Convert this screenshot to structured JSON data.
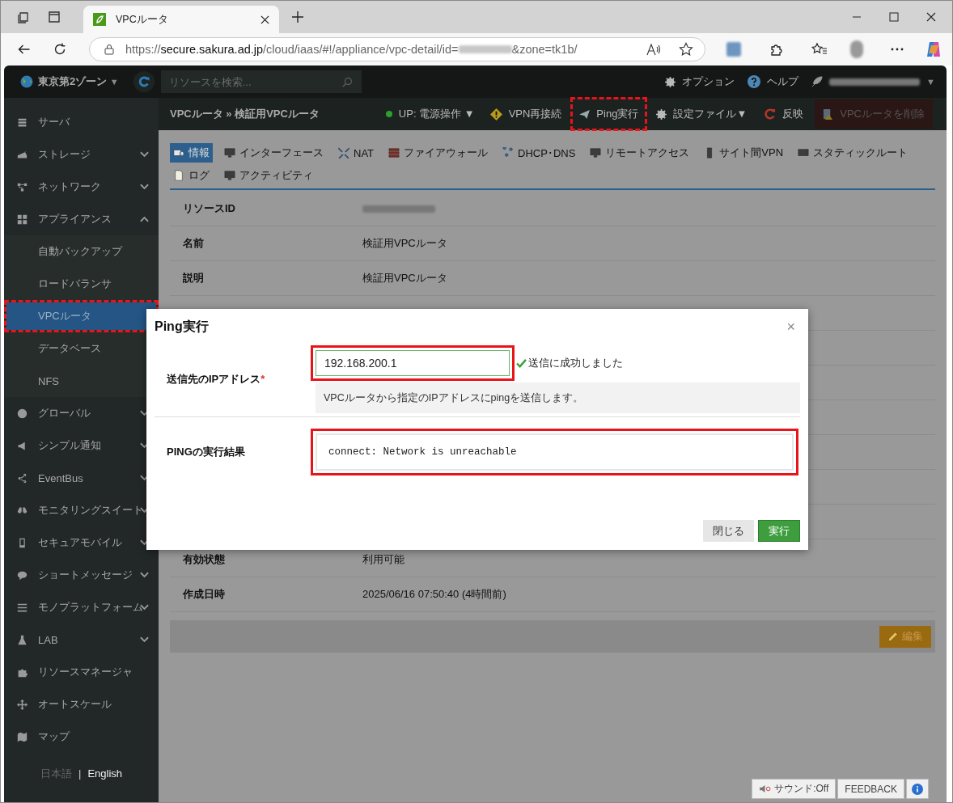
{
  "browser": {
    "tab": {
      "title": "VPCルータ",
      "selected": true
    },
    "url": {
      "scheme": "https://",
      "host": "secure.sakura.ad.jp",
      "path": "/cloud/iaas/#!/appliance/vpc-detail/id=",
      "suffix": "&zone=tk1b/"
    }
  },
  "topbar": {
    "zone": "東京第2ゾーン",
    "zone_caret": "▼",
    "search": {
      "placeholder": "リソースを検索..."
    },
    "links": [
      {
        "label": "オプション"
      },
      {
        "label": "ヘルプ"
      }
    ],
    "user_caret": "▼"
  },
  "sidebar": {
    "items": [
      {
        "label": "サーバ",
        "selected": false
      },
      {
        "label": "ストレージ",
        "selected": false,
        "expanded": false
      },
      {
        "label": "ネットワーク",
        "selected": false,
        "expanded": false
      },
      {
        "label": "アプライアンス",
        "selected": false,
        "expanded": true,
        "children": [
          {
            "label": "自動バックアップ",
            "selected": false,
            "highlighted": false
          },
          {
            "label": "ロードバランサ",
            "selected": false,
            "highlighted": false
          },
          {
            "label": "VPCルータ",
            "selected": true,
            "highlighted": true
          },
          {
            "label": "データベース",
            "selected": false,
            "highlighted": false
          },
          {
            "label": "NFS",
            "selected": false,
            "highlighted": false
          }
        ]
      },
      {
        "label": "グローバル",
        "selected": false,
        "expanded": false
      },
      {
        "label": "シンプル通知",
        "selected": false,
        "expanded": false
      },
      {
        "label": "EventBus",
        "selected": false,
        "expanded": false
      },
      {
        "label": "モニタリングスイート",
        "selected": false,
        "expanded": false
      },
      {
        "label": "セキュアモバイル",
        "selected": false,
        "expanded": false
      },
      {
        "label": "ショートメッセージ",
        "selected": false,
        "expanded": false
      },
      {
        "label": "モノプラットフォーム",
        "selected": false,
        "expanded": false
      },
      {
        "label": "LAB",
        "selected": false,
        "expanded": false
      },
      {
        "label": "リソースマネージャ",
        "selected": false
      },
      {
        "label": "オートスケール",
        "selected": false
      },
      {
        "label": "マップ",
        "selected": false
      }
    ],
    "languages": [
      {
        "label": "日本語",
        "selected": true
      },
      {
        "label": "English",
        "selected": false
      }
    ],
    "separator": "|"
  },
  "header": {
    "breadcrumb": [
      "VPCルータ",
      "検証用VPCルータ"
    ],
    "breadcrumb_separator": "»",
    "status": {
      "label": "UP: 電源操作",
      "caret": "▼",
      "color": "#2e9e2e"
    },
    "actions": [
      {
        "label": "VPN再接続",
        "disabled": false,
        "highlighted": false
      },
      {
        "label": "Ping実行",
        "disabled": false,
        "highlighted": true
      },
      {
        "label": "設定ファイル",
        "caret": "▼",
        "disabled": false,
        "highlighted": false
      },
      {
        "label": "反映",
        "disabled": false,
        "highlighted": false
      },
      {
        "label": "VPCルータを削除",
        "disabled": true,
        "highlighted": false
      }
    ]
  },
  "tabs": [
    {
      "label": "情報",
      "selected": true
    },
    {
      "label": "インターフェース",
      "selected": false
    },
    {
      "label": "NAT",
      "selected": false
    },
    {
      "label": "ファイアウォール",
      "selected": false
    },
    {
      "label": "DHCP･DNS",
      "selected": false
    },
    {
      "label": "リモートアクセス",
      "selected": false
    },
    {
      "label": "サイト間VPN",
      "selected": false
    },
    {
      "label": "スタティックルート",
      "selected": false
    },
    {
      "label": "ログ",
      "selected": false
    },
    {
      "label": "アクティビティ",
      "selected": false
    }
  ],
  "details": [
    {
      "label": "リソースID",
      "kind": "redacted"
    },
    {
      "label": "名前",
      "kind": "text",
      "value": "検証用VPCルータ"
    },
    {
      "label": "説明",
      "kind": "text",
      "value": "検証用VPCルータ"
    },
    {
      "kind": "hidden"
    },
    {
      "label": "有効状態",
      "kind": "text",
      "value": "利用可能"
    },
    {
      "label": "作成日時",
      "kind": "text",
      "value": "2025/06/16 07:50:40 (4時間前)"
    }
  ],
  "edit_button": "編集",
  "modal": {
    "title": "Ping実行",
    "close": "×",
    "address": {
      "label": "送信先のIPアドレス",
      "required_mark": "*",
      "value": "192.168.200.1",
      "highlighted": true,
      "status": "送信に成功しました",
      "help": "VPCルータから指定のIPアドレスにpingを送信します。"
    },
    "result": {
      "label": "PINGの実行結果",
      "value": "connect: Network is unreachable",
      "highlighted": true
    },
    "buttons": [
      {
        "label": "閉じる",
        "kind": "secondary"
      },
      {
        "label": "実行",
        "kind": "primary"
      }
    ]
  },
  "footer": {
    "sound": "サウンド:Off",
    "feedback": "FEEDBACK"
  }
}
